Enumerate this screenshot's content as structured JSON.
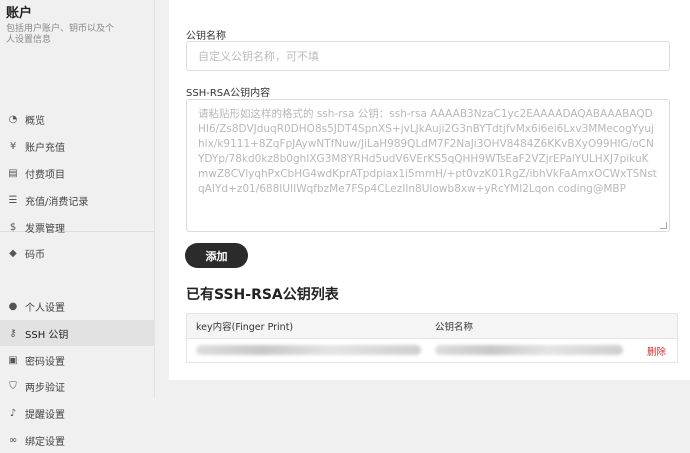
{
  "sidebar": {
    "title": "账户",
    "description": "包括用户账户、钥币以及个人设置信息",
    "items": [
      {
        "label": "概览",
        "icon": "dashboard-icon",
        "glyph": "◔"
      },
      {
        "label": "账户充值",
        "icon": "yen-icon",
        "glyph": "¥"
      },
      {
        "label": "付费项目",
        "icon": "order-icon",
        "glyph": "▤"
      },
      {
        "label": "充值/消费记录",
        "icon": "list-icon",
        "glyph": "☰"
      },
      {
        "label": "发票管理",
        "icon": "dollar-icon",
        "glyph": "$"
      },
      {
        "label": "码币",
        "icon": "coin-icon",
        "glyph": "◆"
      },
      {
        "label": "个人设置",
        "icon": "user-icon",
        "glyph": "●"
      },
      {
        "label": "SSH 公钥",
        "icon": "key-icon",
        "glyph": "⚷",
        "active": true
      },
      {
        "label": "密码设置",
        "icon": "lock-icon",
        "glyph": "▣"
      },
      {
        "label": "两步验证",
        "icon": "shield-icon",
        "glyph": "⛉"
      },
      {
        "label": "提醒设置",
        "icon": "bell-icon",
        "glyph": "♪"
      },
      {
        "label": "绑定设置",
        "icon": "link-icon",
        "glyph": "∞"
      }
    ]
  },
  "form": {
    "name_label": "公钥名称",
    "name_placeholder": "自定义公钥名称，可不填",
    "content_label": "SSH-RSA公钥内容",
    "content_placeholder": "请粘贴形如这样的格式的 ssh-rsa 公钥：ssh-rsa AAAAB3NzaC1yc2EAAAADAQABAAABAQDHI6/Zs8DVJduqR0DHO8s5JDT4SpnXS+jvLJkAuji2G3nBYTdtjfvMx6i6ei6Lxv3MMecogYyujhix/k9111+8ZqFpJAywNTfNuw/JiLaH989QLdM7F2NaJi3OHV8484Z6KKvBXyO99HIG/oCNYDYp/78kd0kz8b0ghIXG3M8YRHd5udV6VErKS5qQHH9WTsEaF2VZjrEPalYULHXJ7pikuKmwZ8CVlyqhPxCbHG4wdKprATpdpiax1i5mmH/+pt0vzK01RgZ/ibhVkFaAmxOCWxTSNstqAIYd+z01/688IUIIWqfbzMe7FSp4CLezIIn8UIowb8xw+yRcYMl2Lqon coding@MBP",
    "add_button": "添加"
  },
  "keys_table": {
    "title": "已有SSH-RSA公钥列表",
    "columns": [
      "key内容(Finger Print)",
      "公钥名称"
    ],
    "rows": [
      {
        "delete_label": "删除"
      }
    ]
  },
  "colors": {
    "button_bg": "#2b2b2b",
    "delete": "#d32f2f",
    "active_item_bg": "#e2e2e2"
  }
}
